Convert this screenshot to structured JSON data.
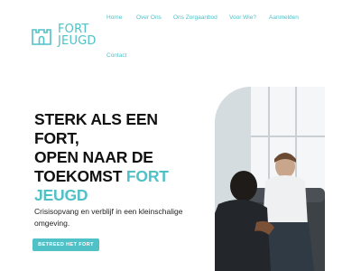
{
  "logo": {
    "line1": "FORT",
    "line2": "JEUGD"
  },
  "nav": {
    "home": "Home",
    "over_ons": "Over Ons",
    "ons_zorgaanbod": "Ons Zorgaanbod",
    "voor_wie": "Voor Wie?",
    "aanmelden": "Aanmelden",
    "contact": "Contact"
  },
  "hero": {
    "line1": "STERK ALS EEN FORT,",
    "line2": "OPEN NAAR DE",
    "line3": "TOEKOMST",
    "accent1": "FORT",
    "accent2": "JEUGD",
    "subtext": "Crisisopvang en verblijf in een kleinschalige omgeving.",
    "cta": "BETREED HET FORT"
  },
  "colors": {
    "accent": "#4fc1c7",
    "text": "#111111"
  },
  "icons": {
    "logo": "castle-icon"
  }
}
